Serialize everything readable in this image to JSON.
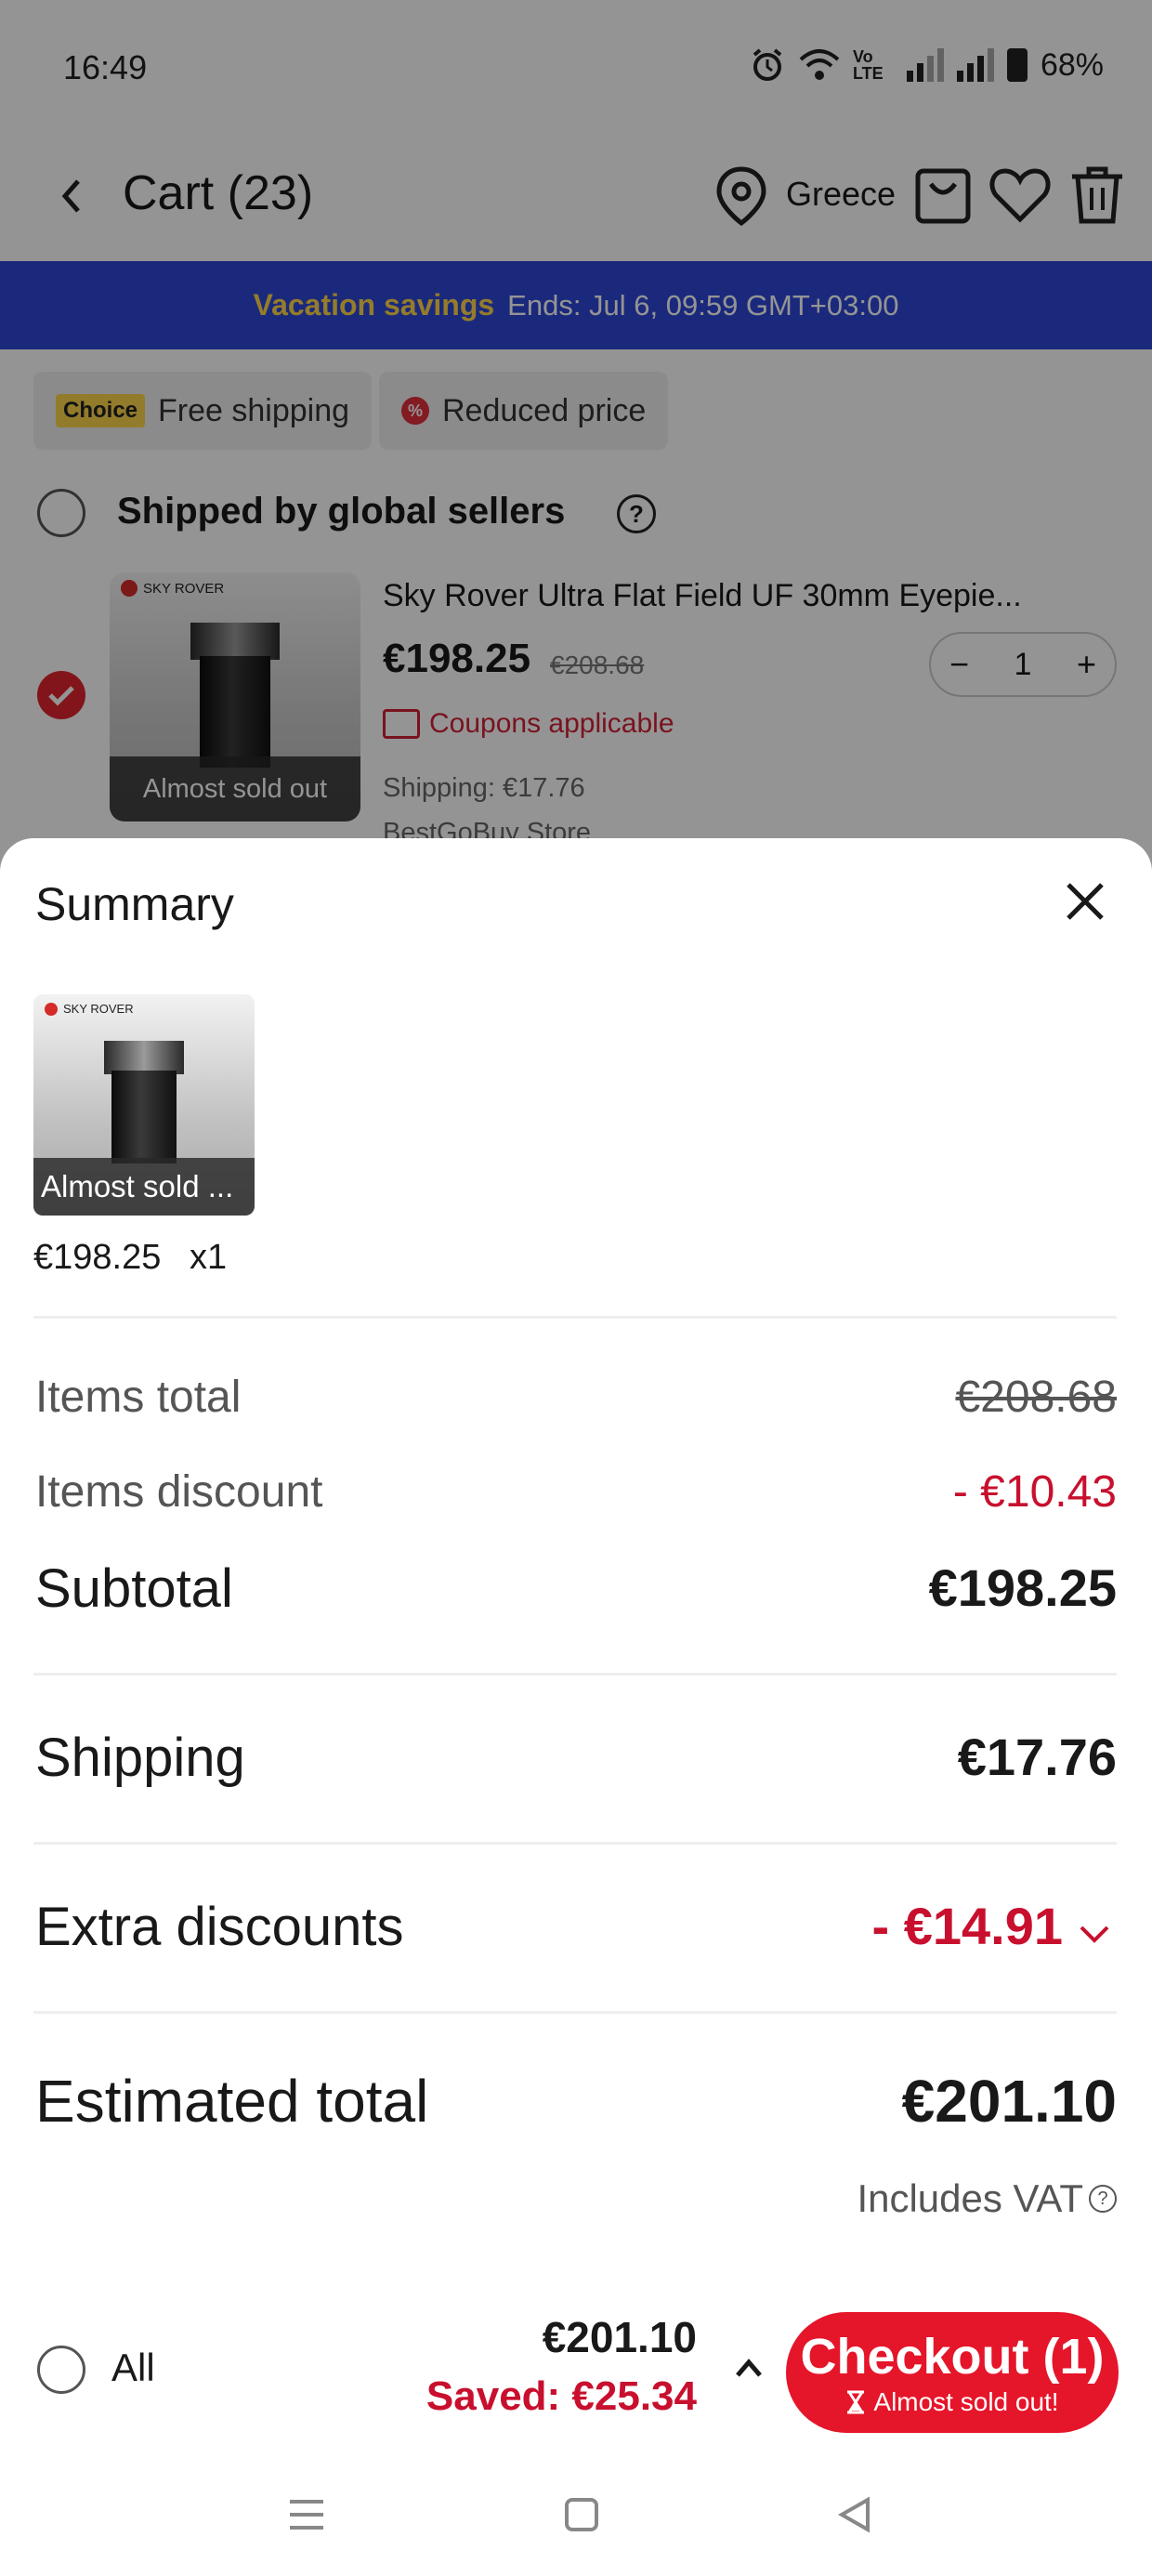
{
  "status_bar": {
    "time": "16:49",
    "network": "Vo LTE",
    "battery": "68%"
  },
  "header": {
    "title": "Cart (23)",
    "country": "Greece"
  },
  "promo": {
    "title": "Vacation savings",
    "ends": "Ends: Jul 6, 09:59 GMT+03:00"
  },
  "chips": {
    "choice_badge": "Choice",
    "free_shipping": "Free shipping",
    "reduced_price": "Reduced price"
  },
  "seller": {
    "title": "Shipped by global sellers"
  },
  "product": {
    "title": "Sky Rover Ultra Flat Field UF 30mm Eyepie...",
    "price": "€198.25",
    "original_price": "€208.68",
    "quantity": "1",
    "badge": "Almost sold out",
    "brand": "SKY ROVER",
    "coupons": "Coupons applicable",
    "shipping": "Shipping: €17.76",
    "store": "BestGoBuy Store"
  },
  "summary": {
    "title": "Summary",
    "item_badge": "Almost sold ...",
    "item_price": "€198.25",
    "item_qty": "x1",
    "items_total_label": "Items total",
    "items_total_value": "€208.68",
    "items_discount_label": "Items discount",
    "items_discount_value": "- €10.43",
    "subtotal_label": "Subtotal",
    "subtotal_value": "€198.25",
    "shipping_label": "Shipping",
    "shipping_value": "€17.76",
    "extra_discounts_label": "Extra discounts",
    "extra_discounts_value": "- €14.91",
    "estimated_total_label": "Estimated total",
    "estimated_total_value": "€201.10",
    "vat_note": "Includes VAT"
  },
  "checkout_bar": {
    "all_label": "All",
    "total": "€201.10",
    "saved": "Saved: €25.34",
    "button_label": "Checkout (1)",
    "button_sub": "Almost sold out!"
  },
  "colors": {
    "accent_red": "#e5152a",
    "promo_blue": "#2e48d6",
    "promo_yellow": "#ffd64a",
    "discount_red": "#c8102e"
  }
}
